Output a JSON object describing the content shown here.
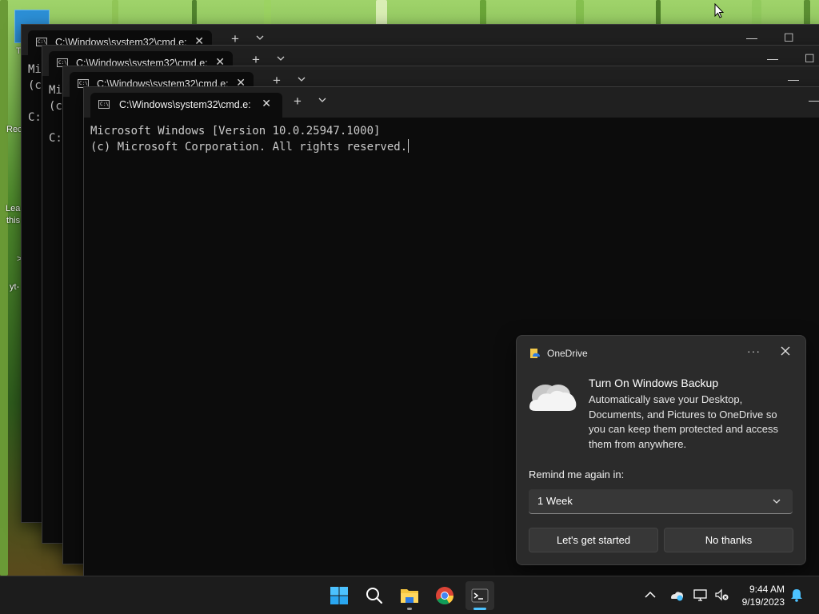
{
  "desktop": {
    "side_texts": [
      "Mi",
      "(c",
      "C:",
      "Rec",
      "Lea",
      "this",
      ">",
      "yt-"
    ]
  },
  "windows": [
    {
      "tab_title": "C:\\Windows\\system32\\cmd.e:",
      "lines": [
        "Mi",
        "(c",
        "",
        "C:"
      ]
    },
    {
      "tab_title": "C:\\Windows\\system32\\cmd.e:",
      "lines": [
        "Mi",
        "(c",
        "",
        "C:"
      ]
    },
    {
      "tab_title": "C:\\Windows\\system32\\cmd.e:",
      "lines": []
    },
    {
      "tab_title": "C:\\Windows\\system32\\cmd.e:",
      "lines": [
        "Microsoft Windows [Version 10.0.25947.1000]",
        "(c) Microsoft Corporation. All rights reserved."
      ]
    }
  ],
  "notification": {
    "app_name": "OneDrive",
    "more_label": "···",
    "heading": "Turn On Windows Backup",
    "body": "Automatically save your Desktop, Documents, and Pictures to OneDrive so you can keep them protected and access them from anywhere.",
    "remind_label": "Remind me again in:",
    "remind_value": "1 Week",
    "primary_button": "Let's get started",
    "secondary_button": "No thanks"
  },
  "taskbar": {
    "apps": [
      "Start",
      "Search",
      "File Explorer",
      "Google Chrome",
      "Terminal"
    ],
    "active_app": "Terminal",
    "clock": {
      "time": "9:44 AM",
      "date": "9/19/2023"
    }
  },
  "colors": {
    "accent": "#4cc2ff",
    "toast_bg": "#2b2b2b",
    "terminal_bg": "#0c0c0c",
    "taskbar_bg": "#1c1c1c"
  }
}
